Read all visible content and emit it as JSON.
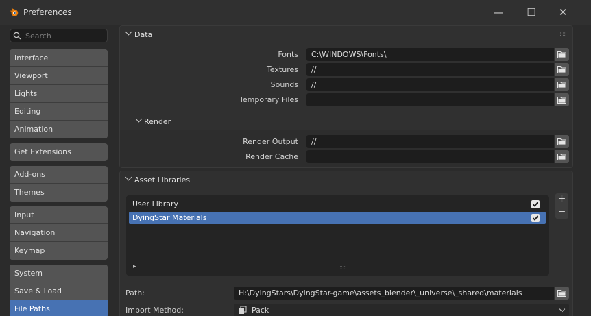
{
  "window": {
    "title": "Preferences",
    "minimize_glyph": "—",
    "maximize_glyph": "☐",
    "close_glyph": "✕"
  },
  "search": {
    "placeholder": "Search"
  },
  "sidebar": {
    "groups": [
      [
        "Interface",
        "Viewport",
        "Lights",
        "Editing",
        "Animation"
      ],
      [
        "Get Extensions"
      ],
      [
        "Add-ons",
        "Themes"
      ],
      [
        "Input",
        "Navigation",
        "Keymap"
      ],
      [
        "System",
        "Save & Load",
        "File Paths"
      ]
    ],
    "active": "File Paths"
  },
  "data_panel": {
    "title": "Data",
    "fields": [
      {
        "label": "Fonts",
        "value": "C:\\WINDOWS\\Fonts\\"
      },
      {
        "label": "Textures",
        "value": "//"
      },
      {
        "label": "Sounds",
        "value": "//"
      },
      {
        "label": "Temporary Files",
        "value": ""
      }
    ],
    "render": {
      "title": "Render",
      "fields": [
        {
          "label": "Render Output",
          "value": "//"
        },
        {
          "label": "Render Cache",
          "value": ""
        }
      ]
    }
  },
  "asset_libraries": {
    "title": "Asset Libraries",
    "items": [
      {
        "name": "User Library",
        "enabled": true
      },
      {
        "name": "DyingStar Materials",
        "enabled": true
      }
    ],
    "selected": "DyingStar Materials",
    "add_glyph": "+",
    "remove_glyph": "−",
    "expand_glyph": "▸",
    "grip_glyph": "::::",
    "path": {
      "label": "Path:",
      "value": "H:\\DyingStars\\DyingStar-game\\assets_blender\\_universe\\_shared\\materials"
    },
    "import_method": {
      "label": "Import Method:",
      "value": "Pack"
    }
  },
  "colors": {
    "accent": "#4772b3",
    "field_bg": "#1d1d1d",
    "button_bg": "#545454",
    "panel_bg": "#303030"
  }
}
